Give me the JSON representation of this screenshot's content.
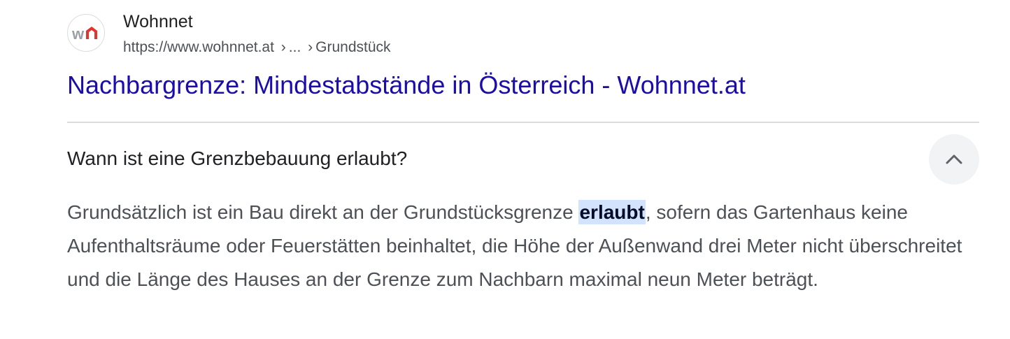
{
  "site": {
    "name": "Wohnnet",
    "url": "https://www.wohnnet.at",
    "breadcrumb_sep1": "›",
    "breadcrumb_ellipsis": "...",
    "breadcrumb_sep2": "›",
    "breadcrumb_path": "Grundstück",
    "favicon": "wohnnet-logo",
    "favicon_colors": {
      "grey": "#9aa0a6",
      "red": "#e5322d"
    }
  },
  "result": {
    "title": "Nachbargrenze: Mindestabstände in Österreich - Wohnnet.at"
  },
  "faq": {
    "question": "Wann ist eine Grenzbebauung erlaubt?",
    "toggle_icon": "chevron-up-icon",
    "answer_before": "Grundsätzlich ist ein Bau direkt an der Grundstücksgrenze ",
    "answer_highlight": "erlaubt",
    "answer_after": ", sofern das Gartenhaus keine Aufenthaltsräume oder Feuerstätten beinhaltet, die Höhe der Außenwand drei Meter nicht überschreitet und die Länge des Hauses an der Grenze zum Nachbarn maximal neun Meter beträgt."
  },
  "colors": {
    "link": "#1a0dab",
    "text": "#202124",
    "secondary_text": "#4d5156",
    "highlight_bg": "#d3e3fd",
    "divider": "#dadce0"
  }
}
